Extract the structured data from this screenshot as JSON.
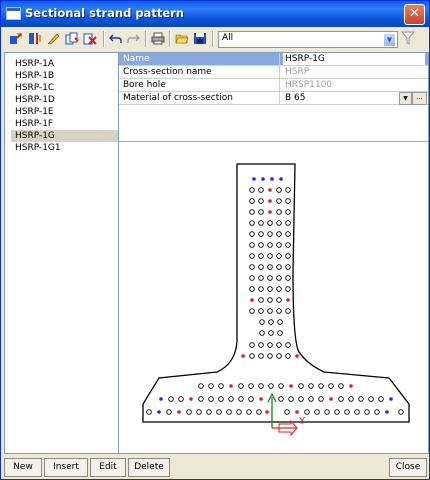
{
  "window": {
    "title": "Sectional strand pattern",
    "close_symbol": "✕"
  },
  "toolbar": {
    "filter": {
      "selected": "All"
    }
  },
  "strand_list": {
    "items": [
      "HSRP-1A",
      "HSRP-1B",
      "HSRP-1C",
      "HSRP-1D",
      "HSRP-1E",
      "HSRP-1F",
      "HSRP-1G",
      "HSRP-1G1"
    ],
    "selected_index": 6
  },
  "properties": {
    "rows": [
      {
        "name": "Name",
        "value": "HSRP-1G"
      },
      {
        "name": "Cross-section name",
        "value": "HSRP"
      },
      {
        "name": "Bore hole",
        "value": "HRSP1100"
      },
      {
        "name": "Material of cross-section",
        "value": "B 65"
      }
    ],
    "dots_label": "..."
  },
  "cross_section": {
    "axis_y_label": "Y",
    "colors": {
      "strand_red": "#e02020",
      "strand_blue": "#2030d0",
      "axis_green": "#109010",
      "axis_red": "#e02020"
    }
  },
  "buttons": {
    "new": "New",
    "insert": "Insert",
    "edit": "Edit",
    "delete": "Delete",
    "close": "Close"
  }
}
